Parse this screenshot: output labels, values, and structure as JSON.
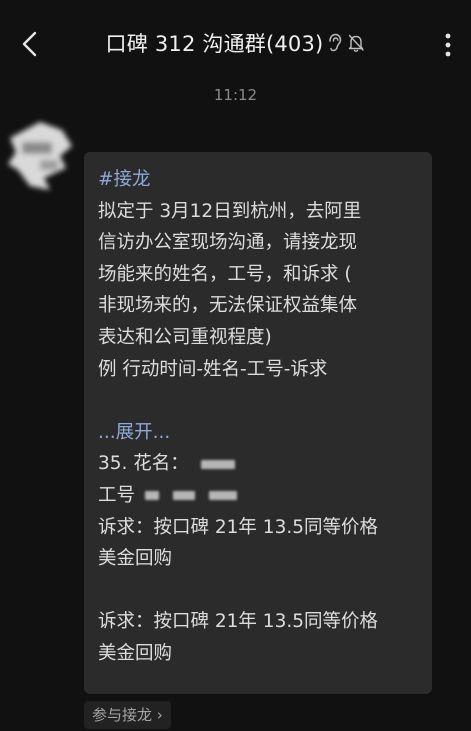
{
  "header": {
    "title": "口碑 312 沟通群(403)",
    "back_icon": "chevron-left-icon",
    "ear_icon": "ear-icon",
    "mute_icon": "bell-off-icon",
    "more_icon": "more-vertical-icon"
  },
  "chat": {
    "timestamp": "11:12",
    "message": {
      "hashtag": "#接龙",
      "lines": [
        "拟定于 3月12日到杭州，去阿里",
        "信访办公室现场沟通，请接龙现",
        "场能来的姓名，工号，和诉求 (",
        "非现场来的，无法保证权益集体",
        "表达和公司重视程度)",
        "例 行动时间-姓名-工号-诉求"
      ],
      "expand_label": "...展开...",
      "entry_name_label": "35. 花名：",
      "entry_id_label": "工号",
      "appeal_1_line1": "诉求：按口碑 21年 13.5同等价格",
      "appeal_1_line2": "美金回购",
      "appeal_2_line1": "诉求：按口碑 21年 13.5同等价格",
      "appeal_2_line2": "美金回购"
    },
    "join_chip": "参与接龙 ›"
  },
  "colors": {
    "background": "#111111",
    "bubble": "#2b2b2b",
    "link": "#8ea8d8",
    "muted_text": "#8b8b8b"
  }
}
